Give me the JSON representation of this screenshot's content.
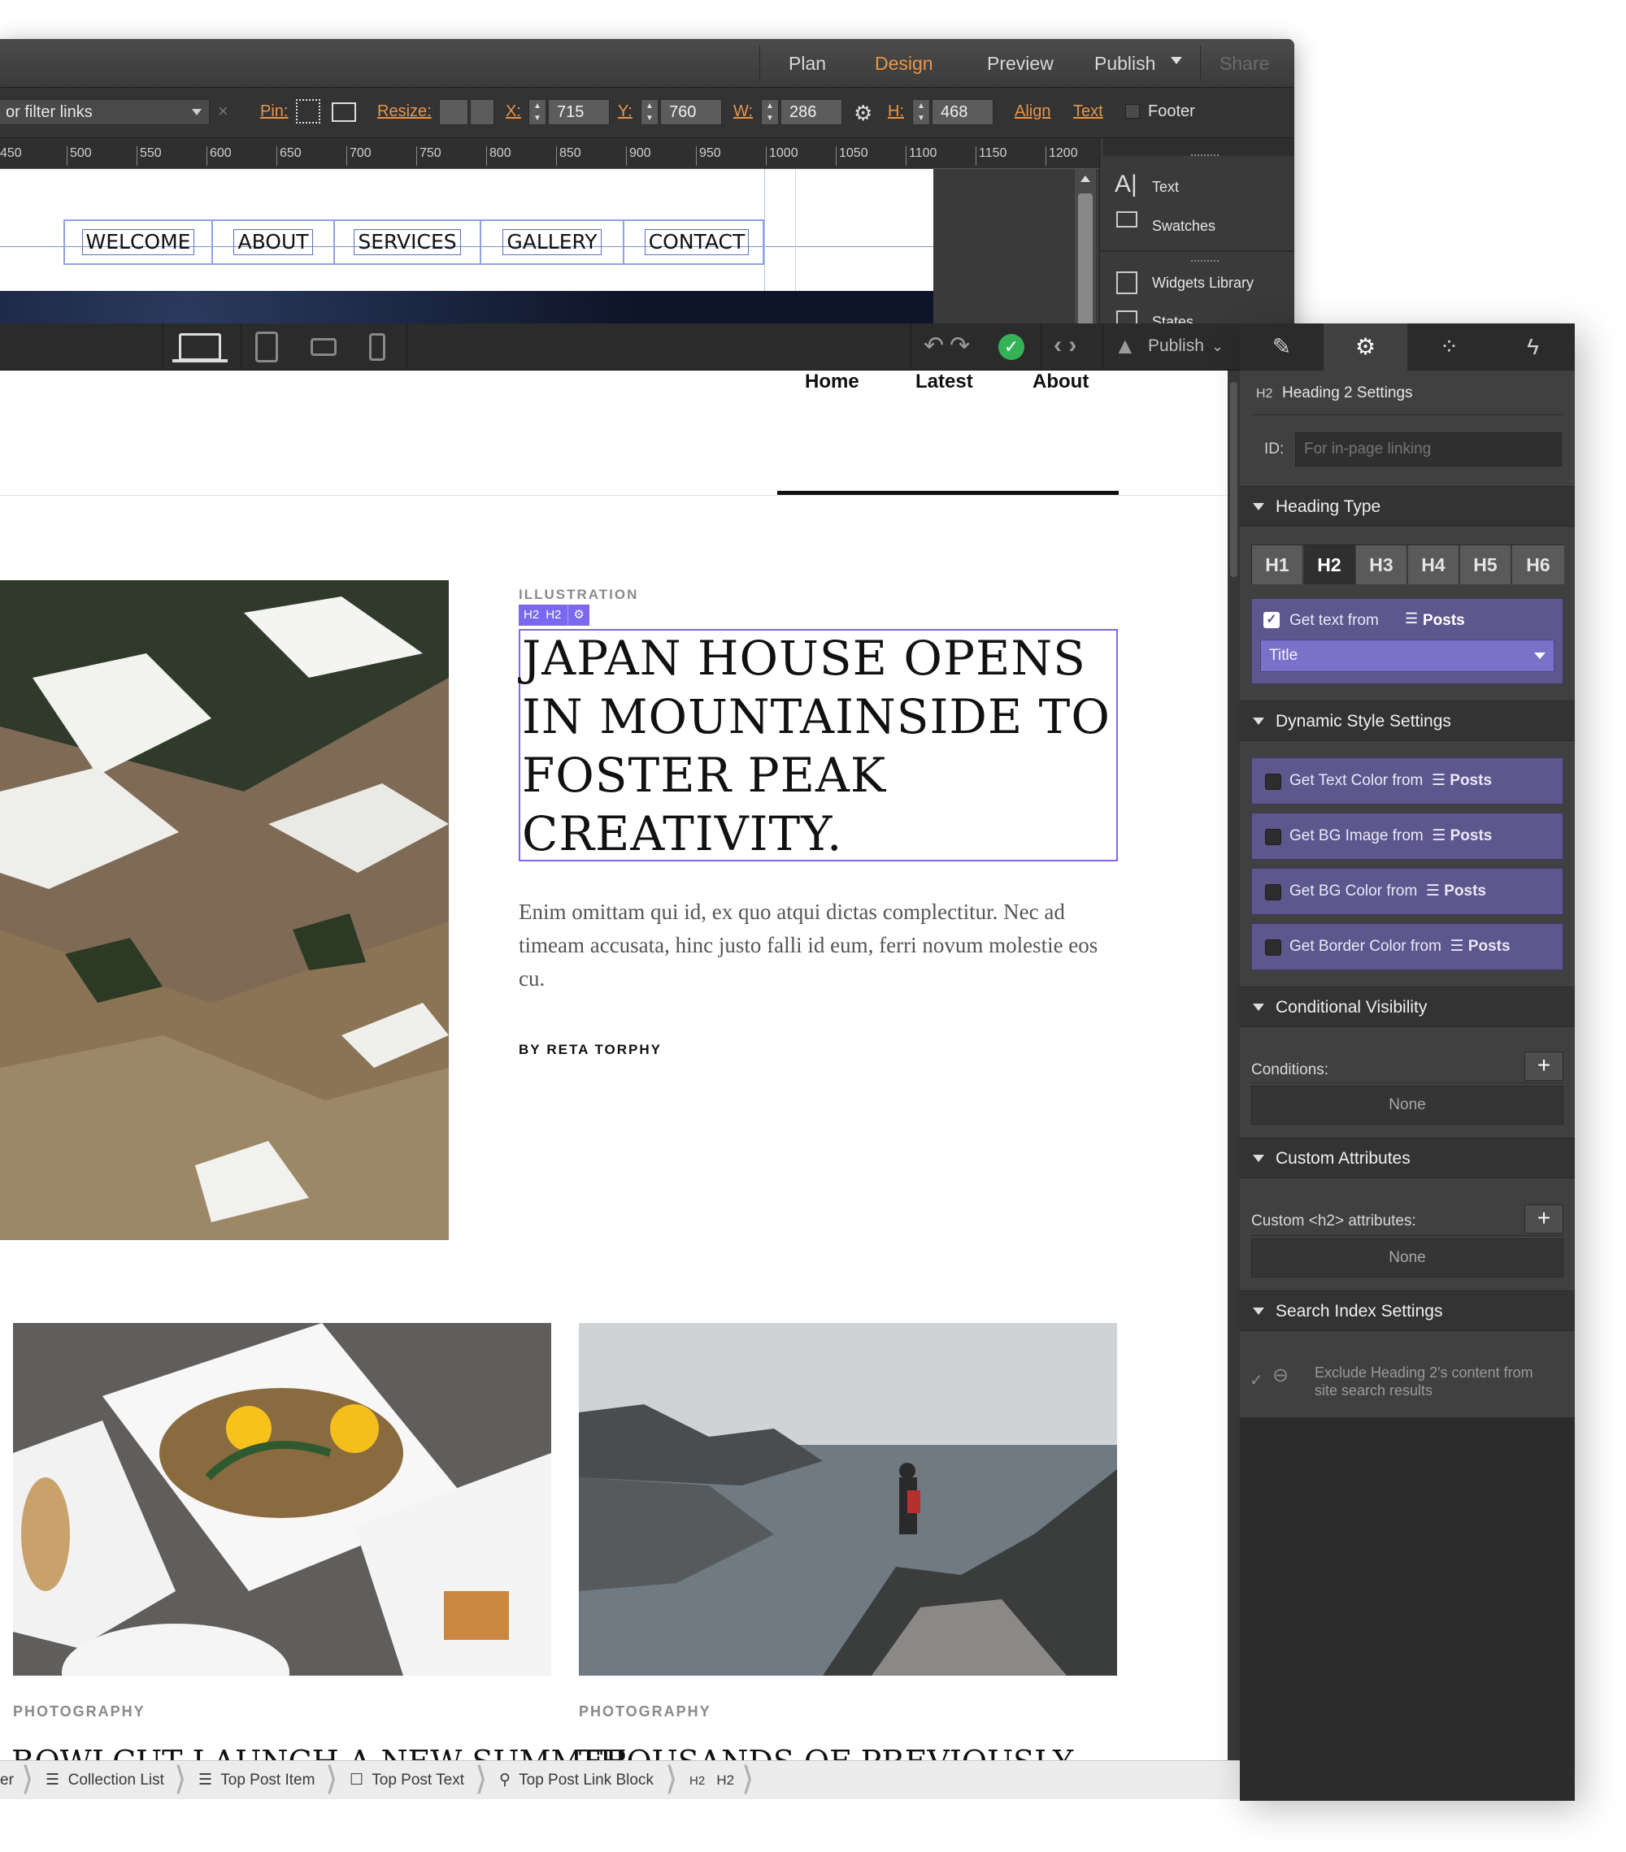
{
  "old_editor": {
    "modes": [
      "Plan",
      "Design",
      "Preview",
      "Publish",
      "Share"
    ],
    "active_mode": "Design",
    "filter_placeholder": "or filter links",
    "pin_label": "Pin:",
    "resize_label": "Resize:",
    "x_label": "X:",
    "x_value": "715",
    "y_label": "Y:",
    "y_value": "760",
    "w_label": "W:",
    "w_value": "286",
    "h_label": "H:",
    "h_value": "468",
    "align_label": "Align",
    "text_label": "Text",
    "footer_label": "Footer",
    "ruler_ticks": [
      "450",
      "500",
      "550",
      "600",
      "650",
      "700",
      "750",
      "800",
      "850",
      "900",
      "950",
      "1000",
      "1050",
      "1100",
      "1150",
      "1200"
    ],
    "nav_items": [
      "WELCOME",
      "ABOUT",
      "SERVICES",
      "GALLERY",
      "CONTACT"
    ],
    "panel_items": [
      "Text",
      "Swatches",
      "Widgets Library",
      "States"
    ]
  },
  "toolbar": {
    "publish_label": "Publish"
  },
  "site": {
    "nav": [
      "Home",
      "Latest",
      "About"
    ],
    "featured": {
      "category": "ILLUSTRATION",
      "badge": "H2",
      "badge_tag": "H2",
      "title": "JAPAN HOUSE OPENS IN MOUNTAINSIDE TO FOSTER PEAK CREATIVITY.",
      "excerpt": "Enim omittam qui id, ex quo atqui dictas complectitur. Nec ad timeam accusata, hinc justo falli id eum, ferri novum molestie eos cu.",
      "byline_prefix": "BY",
      "author": "RETA TORPHY"
    },
    "cards": [
      {
        "category": "PHOTOGRAPHY",
        "title_partial": "BOWLCUT LAUNCH A NEW SUMMER"
      },
      {
        "category": "PHOTOGRAPHY",
        "title_partial": "THOUSANDS OF PREVIOUSLY"
      }
    ]
  },
  "breadcrumbs": [
    "er",
    "Collection List",
    "Top Post Item",
    "Top Post Text",
    "Top Post Link Block",
    "H2"
  ],
  "settings_panel": {
    "header_tag": "H2",
    "header_title": "Heading 2 Settings",
    "id_label": "ID:",
    "id_placeholder": "For in-page linking",
    "heading_type": {
      "title": "Heading Type",
      "options": [
        "H1",
        "H2",
        "H3",
        "H4",
        "H5",
        "H6"
      ],
      "selected": "H2"
    },
    "get_text_from": "Get text from",
    "collection": "Posts",
    "field_value": "Title",
    "dynamic_style": {
      "title": "Dynamic Style Settings",
      "items": [
        "Get Text Color from",
        "Get BG Image from",
        "Get BG Color from",
        "Get Border Color from"
      ]
    },
    "conditional_visibility": {
      "title": "Conditional Visibility",
      "conditions_label": "Conditions:",
      "value": "None"
    },
    "custom_attributes": {
      "title": "Custom Attributes",
      "label": "Custom <h2> attributes:",
      "value": "None"
    },
    "search_index": {
      "title": "Search Index Settings",
      "exclude_text": "Exclude Heading 2's content from site search results"
    }
  },
  "colors": {
    "accent_orange": "#e8954b",
    "purple_panel": "#5d578e",
    "selection_purple": "#7b68ee",
    "check_green": "#35b255"
  }
}
